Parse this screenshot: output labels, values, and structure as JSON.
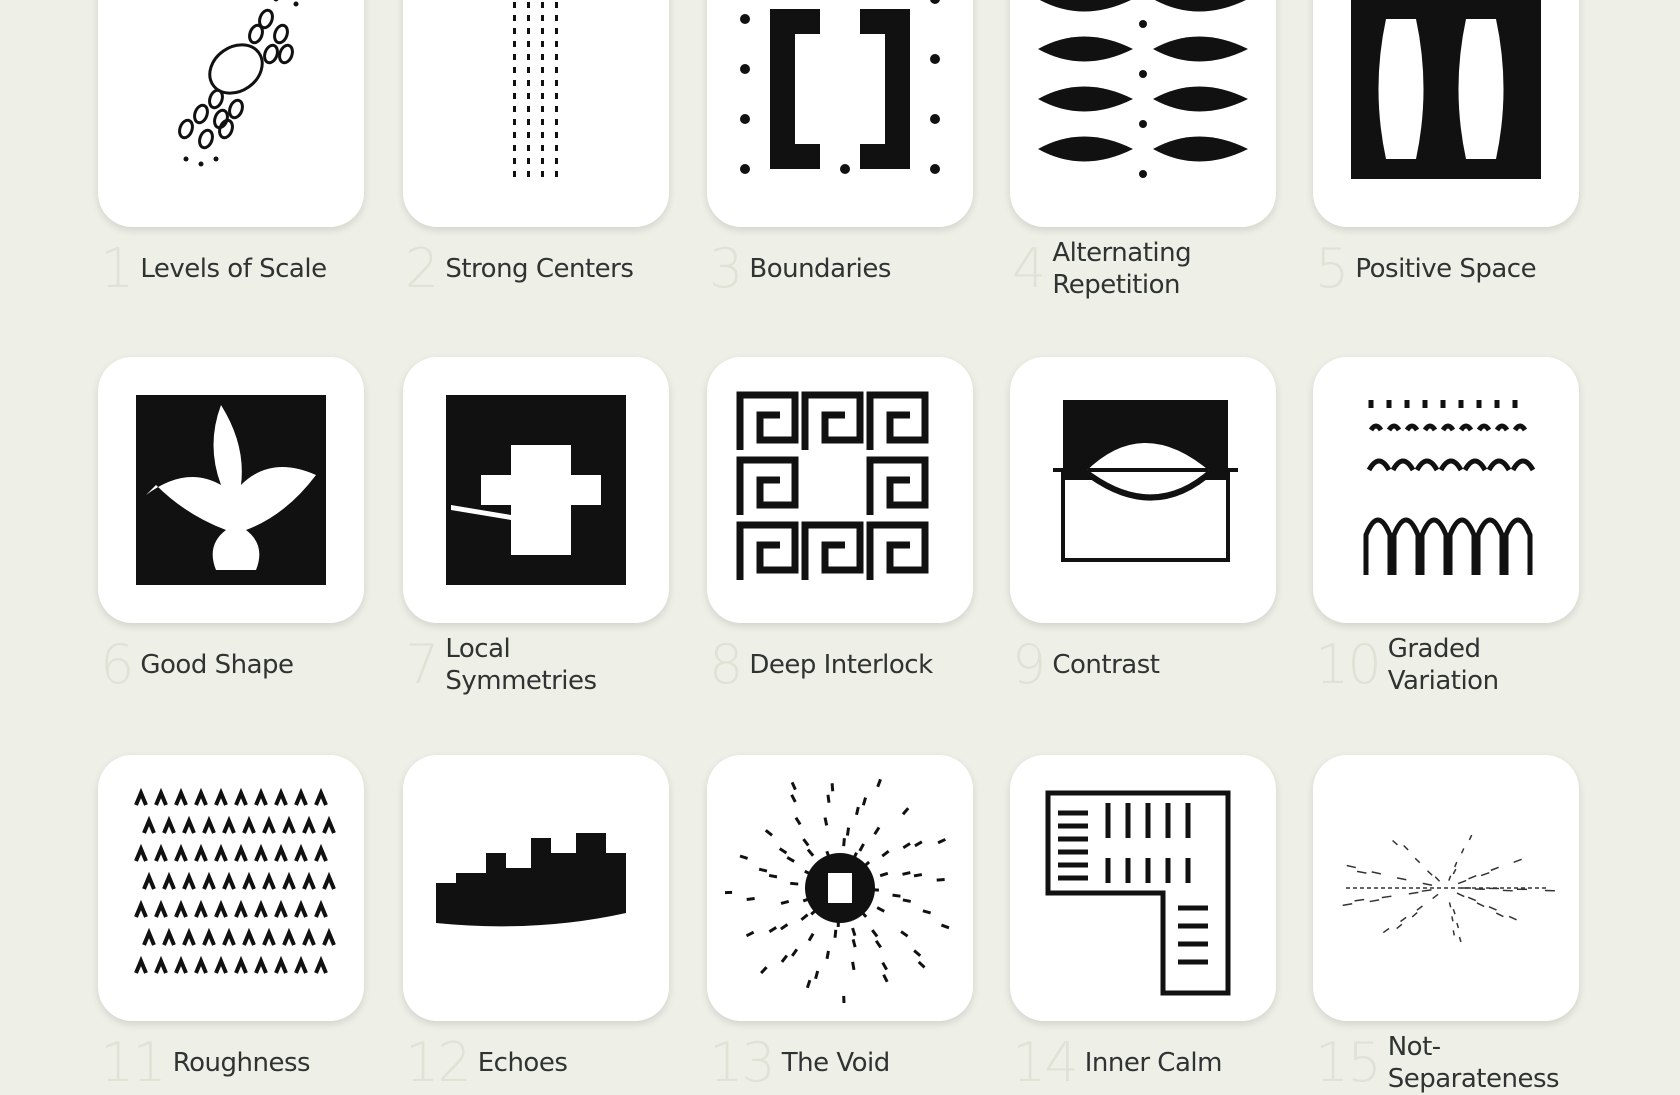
{
  "properties": [
    {
      "number": "1",
      "name": "Levels of Scale",
      "icon": "levels-of-scale-sketch"
    },
    {
      "number": "2",
      "name": "Strong Centers",
      "icon": "strong-centers-sketch"
    },
    {
      "number": "3",
      "name": "Boundaries",
      "icon": "boundaries-sketch"
    },
    {
      "number": "4",
      "name": "Alternating Repetition",
      "icon": "alternating-repetition-sketch"
    },
    {
      "number": "5",
      "name": "Positive Space",
      "icon": "positive-space-sketch"
    },
    {
      "number": "6",
      "name": "Good Shape",
      "icon": "good-shape-sketch"
    },
    {
      "number": "7",
      "name": "Local Symmetries",
      "icon": "local-symmetries-sketch"
    },
    {
      "number": "8",
      "name": "Deep Interlock",
      "icon": "deep-interlock-sketch"
    },
    {
      "number": "9",
      "name": "Contrast",
      "icon": "contrast-sketch"
    },
    {
      "number": "10",
      "name": "Graded Variation",
      "icon": "graded-variation-sketch"
    },
    {
      "number": "11",
      "name": "Roughness",
      "icon": "roughness-sketch"
    },
    {
      "number": "12",
      "name": "Echoes",
      "icon": "echoes-sketch"
    },
    {
      "number": "13",
      "name": "The Void",
      "icon": "the-void-sketch"
    },
    {
      "number": "14",
      "name": "Inner Calm",
      "icon": "inner-calm-sketch"
    },
    {
      "number": "15",
      "name": "Not-Separateness",
      "icon": "not-separateness-sketch"
    }
  ]
}
